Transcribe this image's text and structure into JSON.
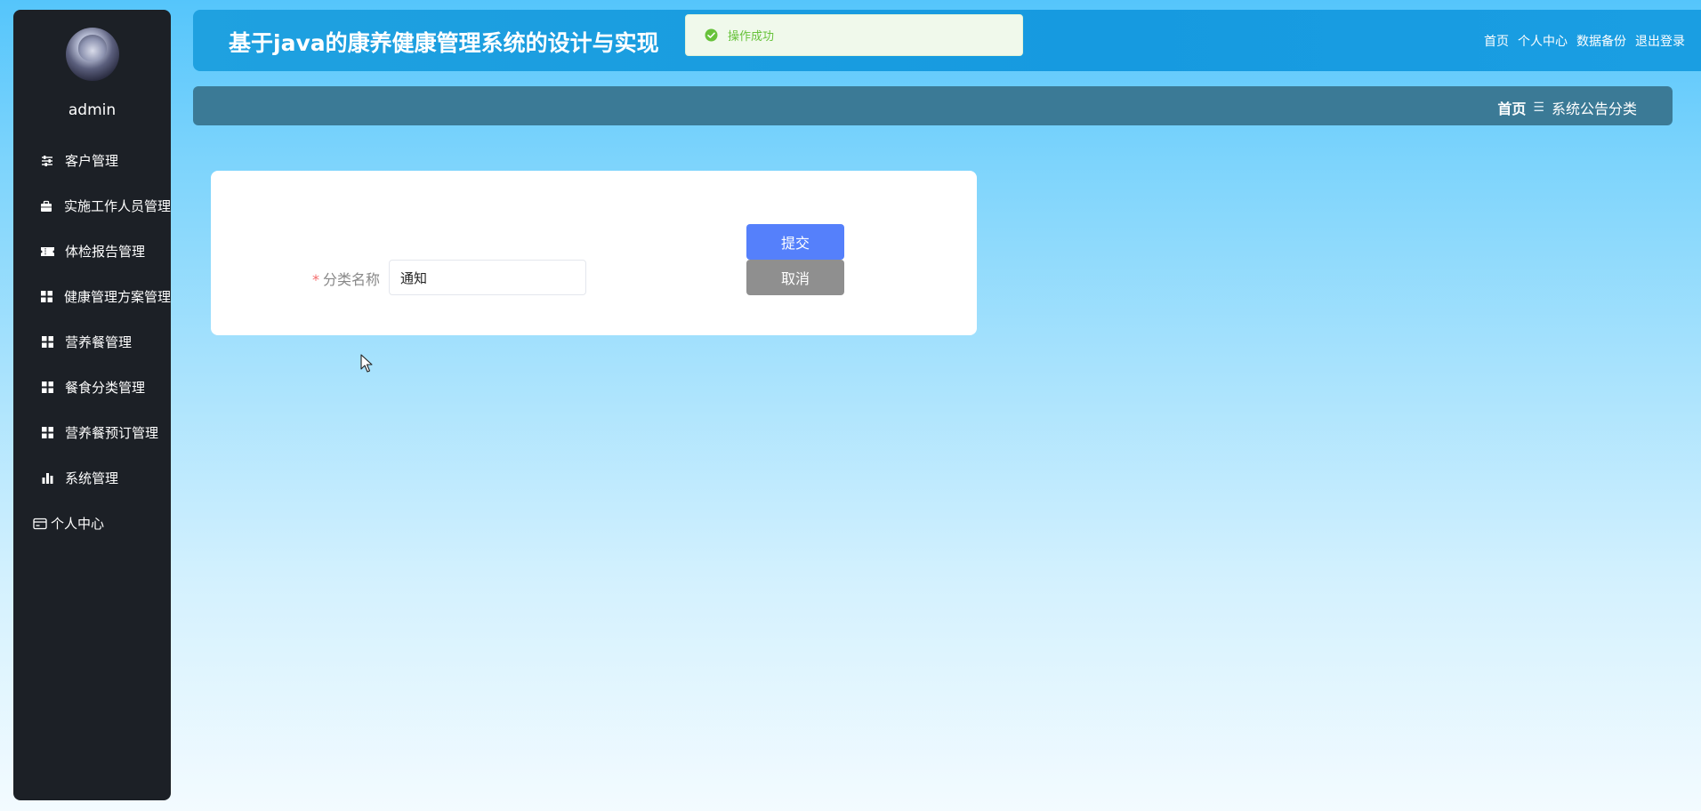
{
  "user": {
    "name": "admin"
  },
  "sidebar": {
    "items": [
      {
        "label": "客户管理",
        "icon": "sliders-icon"
      },
      {
        "label": "实施工作人员管理",
        "icon": "briefcase-icon"
      },
      {
        "label": "体检报告管理",
        "icon": "ticket-icon"
      },
      {
        "label": "健康管理方案管理",
        "icon": "grid-icon"
      },
      {
        "label": "营养餐管理",
        "icon": "grid-icon"
      },
      {
        "label": "餐食分类管理",
        "icon": "grid-icon"
      },
      {
        "label": "营养餐预订管理",
        "icon": "grid-icon"
      },
      {
        "label": "系统管理",
        "icon": "bar-chart-icon"
      },
      {
        "label": "个人中心",
        "icon": "card-icon"
      }
    ]
  },
  "header": {
    "title": "基于java的康养健康管理系统的设计与实现",
    "links": [
      "首页",
      "个人中心",
      "数据备份",
      "退出登录"
    ]
  },
  "toast": {
    "message": "操作成功",
    "color": "#67c23a"
  },
  "breadcrumb": {
    "home": "首页",
    "separator": "☰",
    "current": "系统公告分类"
  },
  "form": {
    "required_mark": "*",
    "field_label": "分类名称",
    "field_value": "通知",
    "submit_label": "提交",
    "cancel_label": "取消"
  },
  "colors": {
    "sidebar_bg": "#1c2026",
    "header_bg": "#169ae0",
    "breadcrumb_bg": "#3b7a96",
    "submit_bg": "#5580fb",
    "cancel_bg": "#8f8f8f"
  }
}
